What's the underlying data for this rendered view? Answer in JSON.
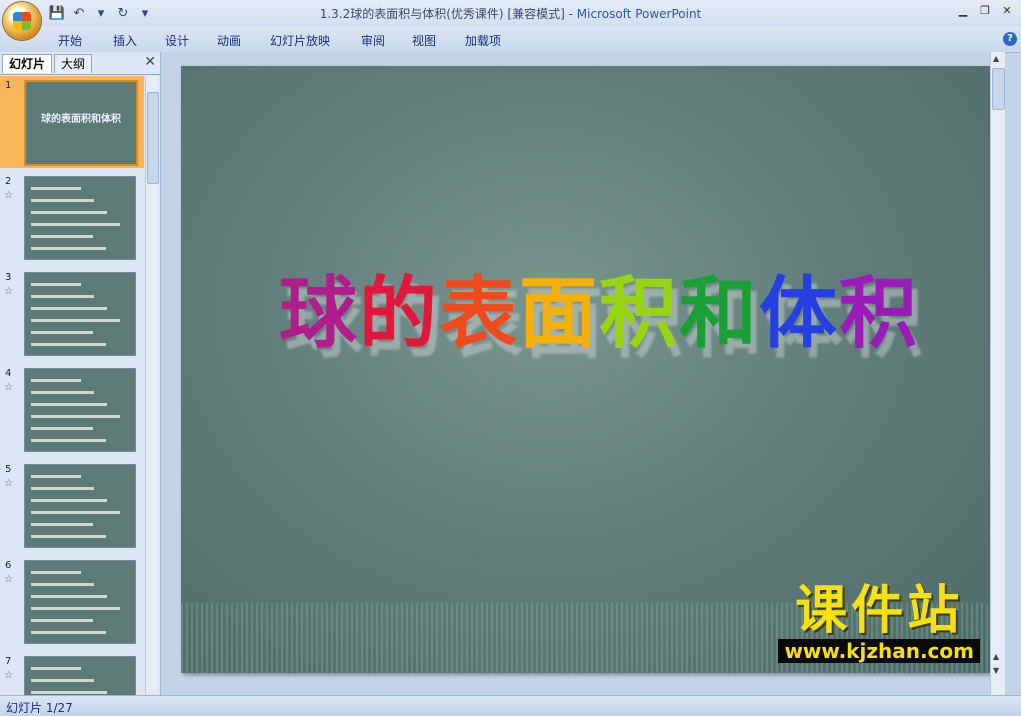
{
  "window": {
    "title_doc": "1.3.2球的表面积与体积(优秀课件) [兼容模式] - ",
    "title_app": "Microsoft PowerPoint"
  },
  "qat": [
    {
      "icon": "save-icon",
      "glyph": "💾"
    },
    {
      "icon": "undo-icon",
      "glyph": "↶"
    },
    {
      "icon": "dropdown-icon",
      "glyph": "▾"
    },
    {
      "icon": "redo-icon",
      "glyph": "↻"
    },
    {
      "icon": "customize-icon",
      "glyph": "▾"
    }
  ],
  "ribbon_tabs": [
    "开始",
    "插入",
    "设计",
    "动画",
    "幻灯片放映",
    "审阅",
    "视图",
    "加载项"
  ],
  "pane_tabs": {
    "slides": "幻灯片",
    "outline": "大纲"
  },
  "thumbnails": [
    {
      "num": "1",
      "star": "",
      "title": "球的表面积和体积"
    },
    {
      "num": "2",
      "star": "☆",
      "title": ""
    },
    {
      "num": "3",
      "star": "☆",
      "title": ""
    },
    {
      "num": "4",
      "star": "☆",
      "title": ""
    },
    {
      "num": "5",
      "star": "☆",
      "title": ""
    },
    {
      "num": "6",
      "star": "☆",
      "title": ""
    },
    {
      "num": "7",
      "star": "☆",
      "title": ""
    }
  ],
  "slide": {
    "title_chars": [
      {
        "ch": "球",
        "color": "#b01e8c"
      },
      {
        "ch": "的",
        "color": "#e0183c"
      },
      {
        "ch": "表",
        "color": "#f04a1c"
      },
      {
        "ch": "面",
        "color": "#f6b00c"
      },
      {
        "ch": "积",
        "color": "#98d412"
      },
      {
        "ch": "和",
        "color": "#18a034"
      },
      {
        "ch": "体",
        "color": "#2440e0"
      },
      {
        "ch": "积",
        "color": "#9a1cb8"
      }
    ],
    "watermark_main": "课件站",
    "watermark_url": "www.kjzhan.com"
  },
  "status": {
    "text": "幻灯片 1/27"
  }
}
